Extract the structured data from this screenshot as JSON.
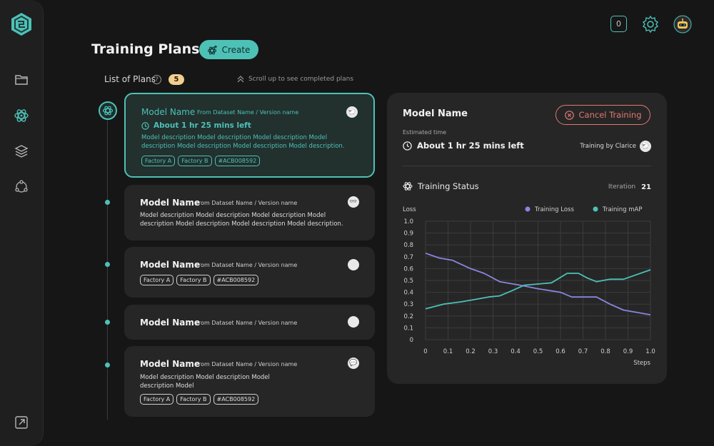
{
  "header": {
    "title": "Training Plans",
    "create_label": "Create",
    "notifications_count": "0"
  },
  "list": {
    "label": "List of Plans",
    "help": "?",
    "count": "5",
    "scroll_hint": "Scroll up to see completed plans"
  },
  "plans": [
    {
      "title": "Model Name",
      "sub": "From Dataset Name / Version name",
      "time": "About 1 hr 25 mins left",
      "desc": "Model description Model description Model description Model description Model description Model description Model description.",
      "tags": [
        "Factory A",
        "Factory B",
        "#ACB008592"
      ]
    },
    {
      "title": "Model Name",
      "sub": "From Dataset Name / Version name",
      "desc": "Model description Model description Model description Model description Model description Model description Model description."
    },
    {
      "title": "Model Name",
      "sub": "From Dataset Name / Version name",
      "tags": [
        "Factory A",
        "Factory B",
        "#ACB008592"
      ]
    },
    {
      "title": "Model Name",
      "sub": "From Dataset Name / Version name"
    },
    {
      "title": "Model Name",
      "sub": "From Dataset Name / Version name",
      "desc": "Model description Model description Model description Model",
      "tags": [
        "Factory A",
        "Factory B",
        "#ACB008592"
      ]
    }
  ],
  "detail": {
    "title": "Model Name",
    "cancel_label": "Cancel Training",
    "est_label": "Estimated time",
    "est_value": "About 1 hr 25 mins left",
    "trained_by": "Training by Clarice",
    "status_title": "Training Status",
    "iteration_label": "Iteration",
    "iteration_value": "21"
  },
  "colors": {
    "accent": "#4ec1b7",
    "loss": "#8a85e0",
    "cancel": "#e2776f",
    "badge": "#f2cf8f"
  },
  "chart_data": {
    "type": "line",
    "ylabel": "Loss",
    "xlabel": "Steps",
    "xlim": [
      0,
      1.0
    ],
    "ylim": [
      0,
      1.0
    ],
    "x_ticks": [
      "0",
      "0.1",
      "0.2",
      "0.3",
      "0.4",
      "0.5",
      "0.6",
      "0.7",
      "0.8",
      "0.9",
      "1.0"
    ],
    "y_ticks": [
      "0",
      "0.1",
      "0.2",
      "0.3",
      "0.4",
      "0.5",
      "0.6",
      "0.7",
      "0.8",
      "0.9",
      "1.0"
    ],
    "grid": true,
    "legend_position": "top-right",
    "series": [
      {
        "name": "Training Loss",
        "color": "#8a85e0",
        "x": [
          0,
          0.06,
          0.12,
          0.2,
          0.26,
          0.33,
          0.42,
          0.5,
          0.6,
          0.65,
          0.7,
          0.76,
          0.82,
          0.88,
          0.94,
          1.0
        ],
        "y": [
          0.73,
          0.69,
          0.67,
          0.6,
          0.56,
          0.49,
          0.46,
          0.43,
          0.4,
          0.36,
          0.36,
          0.36,
          0.3,
          0.25,
          0.23,
          0.21
        ]
      },
      {
        "name": "Training mAP",
        "color": "#4ec1b7",
        "x": [
          0,
          0.08,
          0.16,
          0.22,
          0.28,
          0.33,
          0.38,
          0.44,
          0.5,
          0.56,
          0.63,
          0.68,
          0.72,
          0.76,
          0.82,
          0.88,
          0.94,
          1.0
        ],
        "y": [
          0.26,
          0.3,
          0.32,
          0.34,
          0.36,
          0.37,
          0.41,
          0.46,
          0.47,
          0.48,
          0.56,
          0.56,
          0.52,
          0.49,
          0.51,
          0.51,
          0.55,
          0.59
        ]
      }
    ]
  }
}
